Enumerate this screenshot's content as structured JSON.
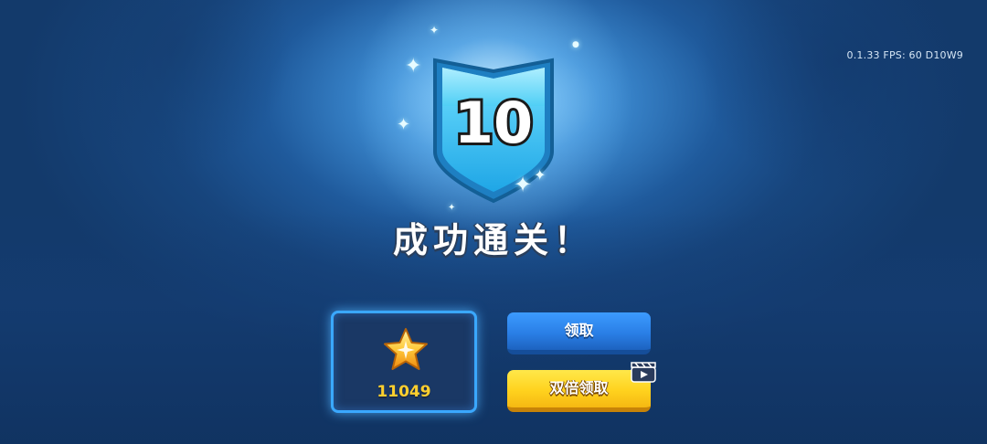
{
  "debug": {
    "info": "0.1.33  FPS:  60  D10W9"
  },
  "badge": {
    "level": "10"
  },
  "title": "成功通关！",
  "reward": {
    "icon": "star-icon",
    "amount": "11049"
  },
  "buttons": {
    "claim_label": "领取",
    "double_claim_label": "双倍领取",
    "double_claim_icon": "video-clapper-icon"
  },
  "colors": {
    "badge_blue": "#35c3f2",
    "reward_gold": "#ffcf2e",
    "claim_blue": "#2a7fe6",
    "double_yellow": "#ffd21e"
  }
}
